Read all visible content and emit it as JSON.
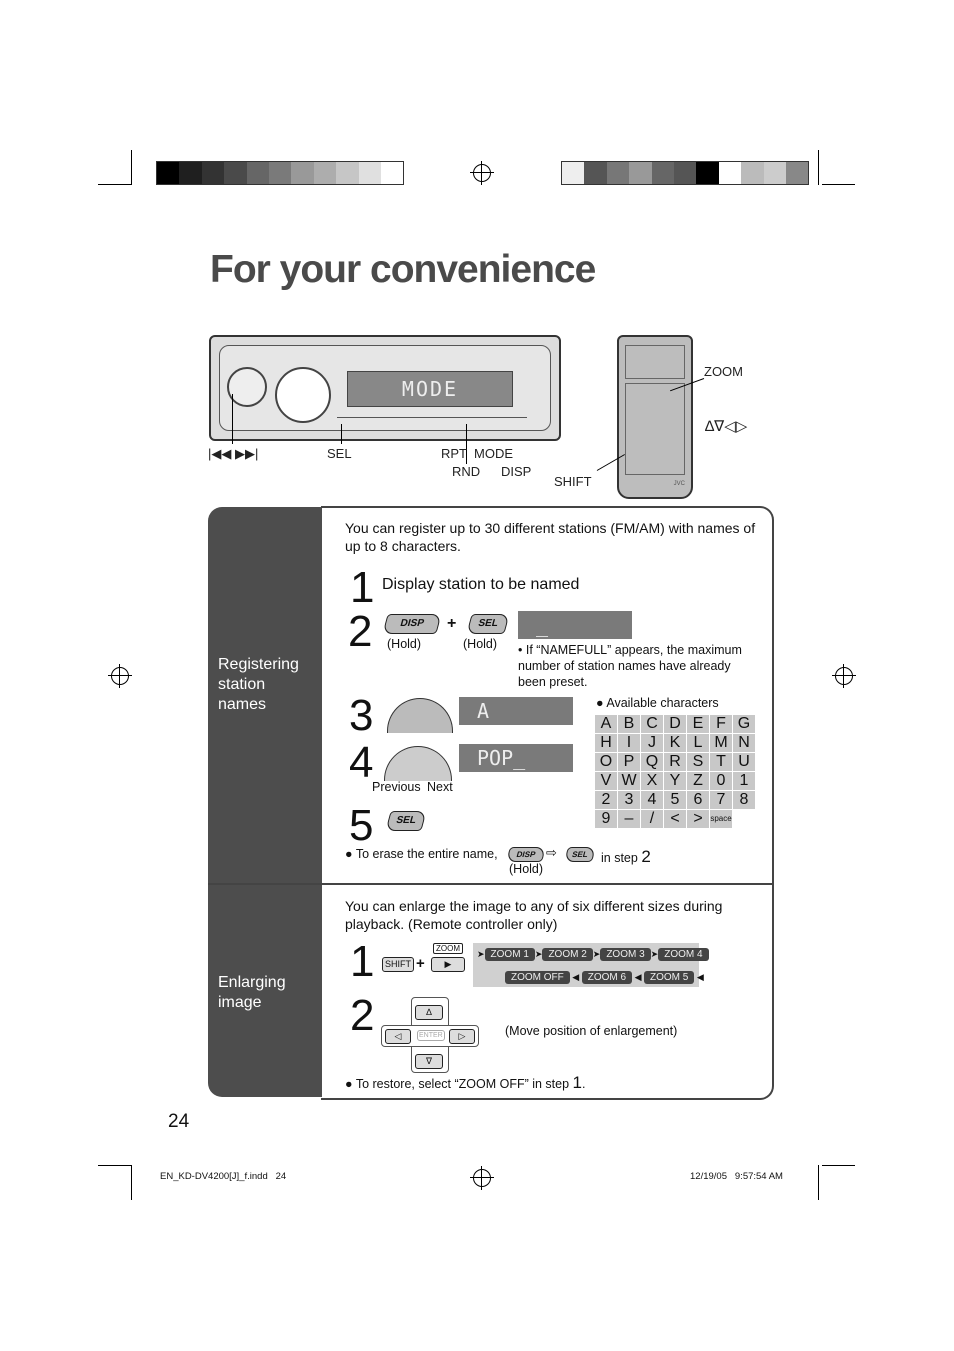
{
  "title": "For your convenience",
  "colors": {
    "sidebar": "#4d4d4d",
    "display": "#7a7a7a"
  },
  "device": {
    "display_text": "MODE",
    "labels": {
      "skip": "|◀◀ ▶▶|",
      "sel": "SEL",
      "rpt": "RPT",
      "mode": "MODE",
      "rnd": "RND",
      "disp": "DISP"
    }
  },
  "remote": {
    "labels": {
      "zoom": "ZOOM",
      "arrows": "∆∇◁▷",
      "shift": "SHIFT",
      "brand": "JVC"
    }
  },
  "section1": {
    "label": "Registering station names",
    "intro": "You can register up to 30 different stations (FM/AM) with names of up to 8 characters.",
    "step1": {
      "num": "1",
      "text": "Display station to be named"
    },
    "step2": {
      "num": "2",
      "btn1": "DISP",
      "btn2": "SEL",
      "hold": "(Hold)",
      "plus": "+",
      "display": "_",
      "note": "If “NAMEFULL” appears, the maximum number of station names have already been preset."
    },
    "step3": {
      "num": "3",
      "display": "A"
    },
    "step4": {
      "num": "4",
      "display": "POP_",
      "previous": "Previous",
      "next": "Next"
    },
    "step5": {
      "num": "5",
      "btn": "SEL"
    },
    "available_label": "Available characters",
    "characters": [
      "A",
      "B",
      "C",
      "D",
      "E",
      "F",
      "G",
      "H",
      "I",
      "J",
      "K",
      "L",
      "M",
      "N",
      "O",
      "P",
      "Q",
      "R",
      "S",
      "T",
      "U",
      "V",
      "W",
      "X",
      "Y",
      "Z",
      "0",
      "1",
      "2",
      "3",
      "4",
      "5",
      "6",
      "7",
      "8",
      "9",
      "–",
      "/",
      "<",
      ">",
      "space"
    ],
    "erase": {
      "text": "To erase the entire name,",
      "btn1": "DISP",
      "btn2": "SEL",
      "suffix": "in step",
      "step": "2",
      "hold": "(Hold)"
    }
  },
  "section2": {
    "label": "Enlarging image",
    "intro": "You can enlarge the image to any of six different sizes during playback. (Remote controller only)",
    "step1": {
      "num": "1",
      "shift": "SHIFT",
      "zoom": "ZOOM",
      "plus": "+"
    },
    "zoom_row1": [
      "ZOOM 1",
      "ZOOM 2",
      "ZOOM 3",
      "ZOOM 4"
    ],
    "zoom_row2": [
      "ZOOM OFF",
      "ZOOM 6",
      "ZOOM 5"
    ],
    "step2": {
      "num": "2",
      "enter": "ENTER",
      "caption": "(Move position of enlargement)"
    },
    "restore": {
      "text": "To restore, select “ZOOM OFF” in step",
      "step": "1"
    }
  },
  "page_number": "24",
  "footer": {
    "file": "EN_KD-DV4200[J]_f.indd   24",
    "date": "12/19/05   9:57:54 AM"
  }
}
